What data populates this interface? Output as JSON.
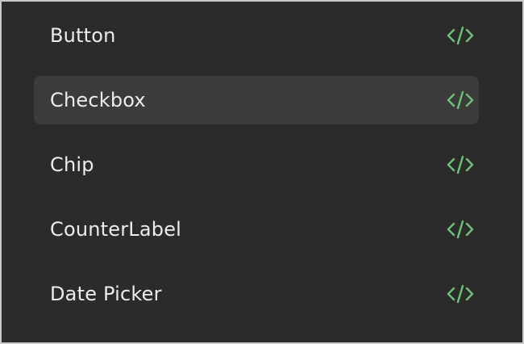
{
  "components": {
    "items": [
      {
        "label": "Button",
        "icon": "code-icon",
        "selected": false
      },
      {
        "label": "Checkbox",
        "icon": "code-icon",
        "selected": true
      },
      {
        "label": "Chip",
        "icon": "code-icon",
        "selected": false
      },
      {
        "label": "CounterLabel",
        "icon": "code-icon",
        "selected": false
      },
      {
        "label": "Date Picker",
        "icon": "code-icon",
        "selected": false
      }
    ]
  },
  "colors": {
    "background": "#2b2b2b",
    "selected_row": "#3b3b3b",
    "text": "#ececec",
    "icon": "#6fbf7a"
  }
}
